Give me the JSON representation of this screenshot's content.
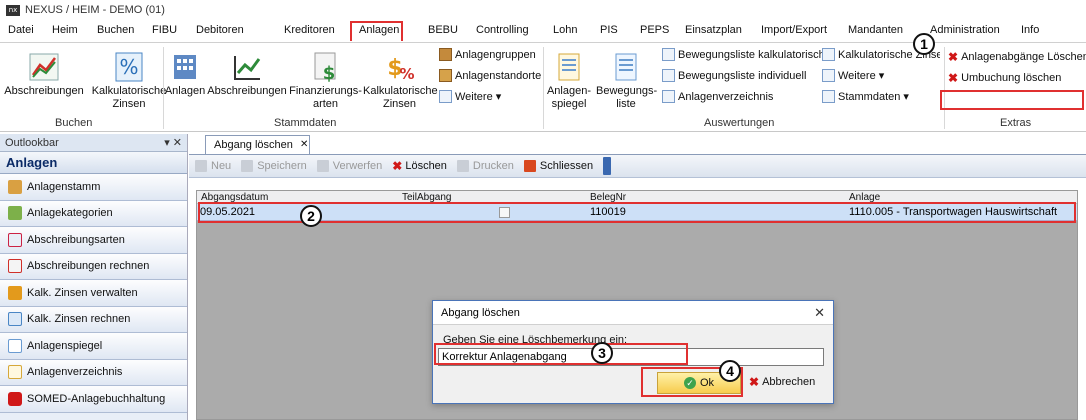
{
  "window": {
    "title": "NEXUS / HEIM - DEMO (01)",
    "app_badge": "nx"
  },
  "menu": [
    "Datei",
    "Heim",
    "Buchen",
    "FIBU",
    "Debitoren",
    "Kreditoren",
    "Anlagen",
    "BEBU",
    "Controlling",
    "Lohn",
    "PIS",
    "PEPS",
    "Einsatzplan",
    "Import/Export",
    "Mandanten",
    "Administration",
    "Info"
  ],
  "ribbon": {
    "buchen": {
      "label": "Buchen",
      "btn_abschreibungen": "Abschreibungen",
      "btn_kalk_zinsen_1": "Kalkulatorische",
      "btn_kalk_zinsen_2": "Zinsen"
    },
    "stammdaten": {
      "label": "Stammdaten",
      "btn_anlagen": "Anlagen",
      "btn_abschreibungen": "Abschreibungen",
      "btn_finanz_1": "Finanzierungs-",
      "btn_finanz_2": "arten",
      "btn_kalk_1": "Kalkulatorische",
      "btn_kalk_2": "Zinsen",
      "anlagengruppen": "Anlagengruppen",
      "anlagenstandorte": "Anlagenstandorte",
      "weitere": "Weitere ▾"
    },
    "auswertungen": {
      "label": "Auswertungen",
      "btn_spiegel_1": "Anlagen-",
      "btn_spiegel_2": "spiegel",
      "btn_bewegung_1": "Bewegungs-",
      "btn_bewegung_2": "liste",
      "bl_kalk": "Bewegungsliste kalkulatorisch",
      "bl_indiv": "Bewegungsliste individuell",
      "verzeichnis": "Anlagenverzeichnis",
      "kalk_zinsen": "Kalkulatorische Zinsen",
      "weitere": "Weitere ▾",
      "stammdaten": "Stammdaten ▾"
    },
    "extras": {
      "label": "Extras",
      "abgaenge_loeschen": "Anlagenabgänge Löschen",
      "umbuchung_loeschen": "Umbuchung löschen"
    }
  },
  "sidebar": {
    "header": "Outlookbar",
    "title": "Anlagen",
    "items": [
      "Anlagenstamm",
      "Anlagekategorien",
      "Abschreibungsarten",
      "Abschreibungen rechnen",
      "Kalk. Zinsen verwalten",
      "Kalk. Zinsen rechnen",
      "Anlagenspiegel",
      "Anlagenverzeichnis",
      "SOMED-Anlagebuchhaltung"
    ]
  },
  "tab": {
    "label": "Abgang löschen"
  },
  "toolbar": {
    "neu": "Neu",
    "speichern": "Speichern",
    "verwerfen": "Verwerfen",
    "loeschen": "Löschen",
    "drucken": "Drucken",
    "schliessen": "Schliessen"
  },
  "grid": {
    "columns": [
      "Abgangsdatum",
      "TeilAbgang",
      "BelegNr",
      "Anlage"
    ],
    "rows": [
      {
        "datum": "09.05.2021",
        "teil": false,
        "beleg": "110019",
        "anlage": "1110.005 - Transportwagen Hauswirtschaft"
      }
    ]
  },
  "dialog": {
    "title": "Abgang löschen",
    "prompt": "Geben Sie eine Löschbemerkung ein:",
    "input_value": "Korrektur Anlagenabgang",
    "ok": "Ok",
    "cancel": "Abbrechen"
  },
  "annotations": [
    "1",
    "2",
    "3",
    "4"
  ]
}
